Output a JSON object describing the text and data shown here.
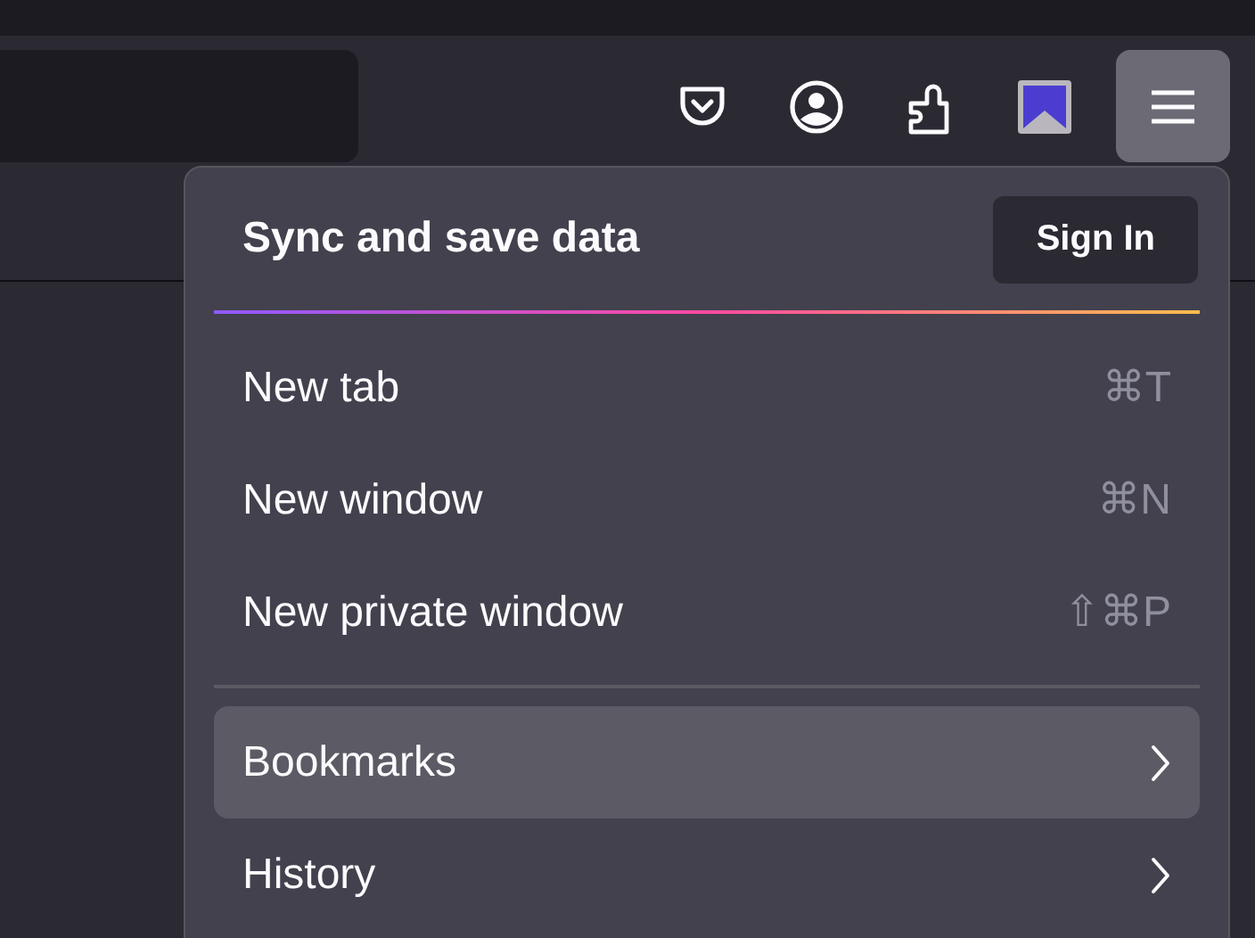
{
  "toolbar": {
    "buttons": [
      {
        "kind": "pocket",
        "selected": false
      },
      {
        "kind": "account",
        "selected": false
      },
      {
        "kind": "extensions",
        "selected": false
      },
      {
        "kind": "bookmark",
        "selected": false
      },
      {
        "kind": "menu",
        "selected": true
      }
    ]
  },
  "menu": {
    "header": {
      "title": "Sync and save data",
      "button": "Sign In"
    },
    "sections": [
      {
        "items": [
          {
            "label": "New tab",
            "shortcut": "⌘T",
            "submenu": false,
            "selected": false
          },
          {
            "label": "New window",
            "shortcut": "⌘N",
            "submenu": false,
            "selected": false
          },
          {
            "label": "New private window",
            "shortcut": "⇧⌘P",
            "submenu": false,
            "selected": false
          }
        ]
      },
      {
        "items": [
          {
            "label": "Bookmarks",
            "submenu": true,
            "selected": true
          },
          {
            "label": "History",
            "submenu": true,
            "selected": false
          }
        ]
      }
    ]
  }
}
